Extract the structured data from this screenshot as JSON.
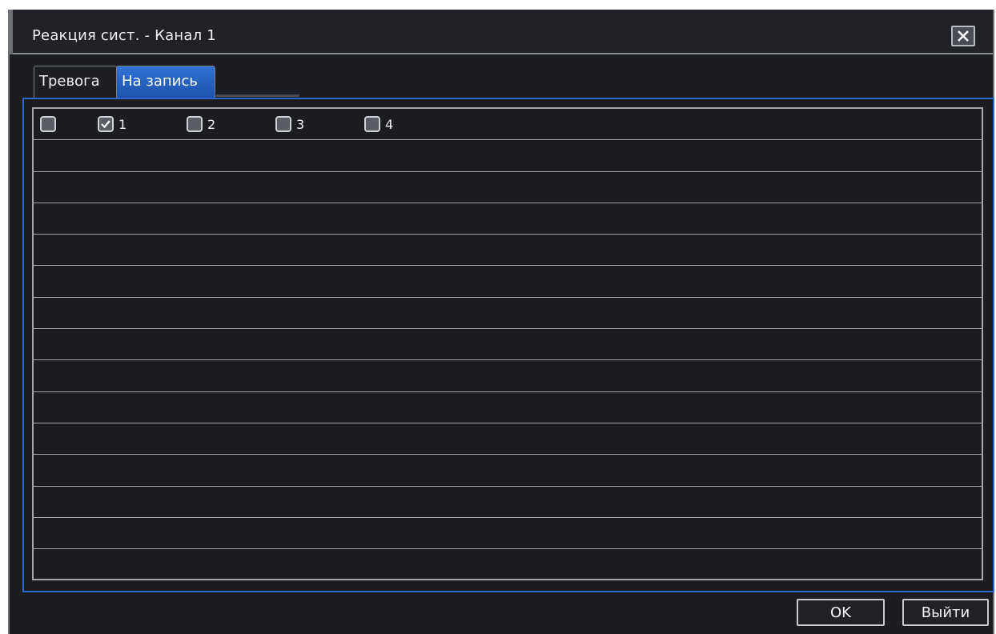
{
  "window": {
    "title": "Реакция сист. - Канал 1"
  },
  "tabs": [
    {
      "label": "Тревога",
      "active": false
    },
    {
      "label": "На запись",
      "active": true
    }
  ],
  "channels": {
    "select_all_checked": false,
    "items": [
      {
        "label": "1",
        "checked": true
      },
      {
        "label": "2",
        "checked": false
      },
      {
        "label": "3",
        "checked": false
      },
      {
        "label": "4",
        "checked": false
      }
    ]
  },
  "buttons": {
    "ok_label": "OK",
    "exit_label": "Выйти"
  },
  "icons": {
    "close": "close-icon",
    "check": "checkmark-icon"
  },
  "colors": {
    "background": "#1c1d22",
    "active_tab": "#2f72d4",
    "panel_border": "#2f66c8",
    "grid_line": "#a5a7ab"
  }
}
